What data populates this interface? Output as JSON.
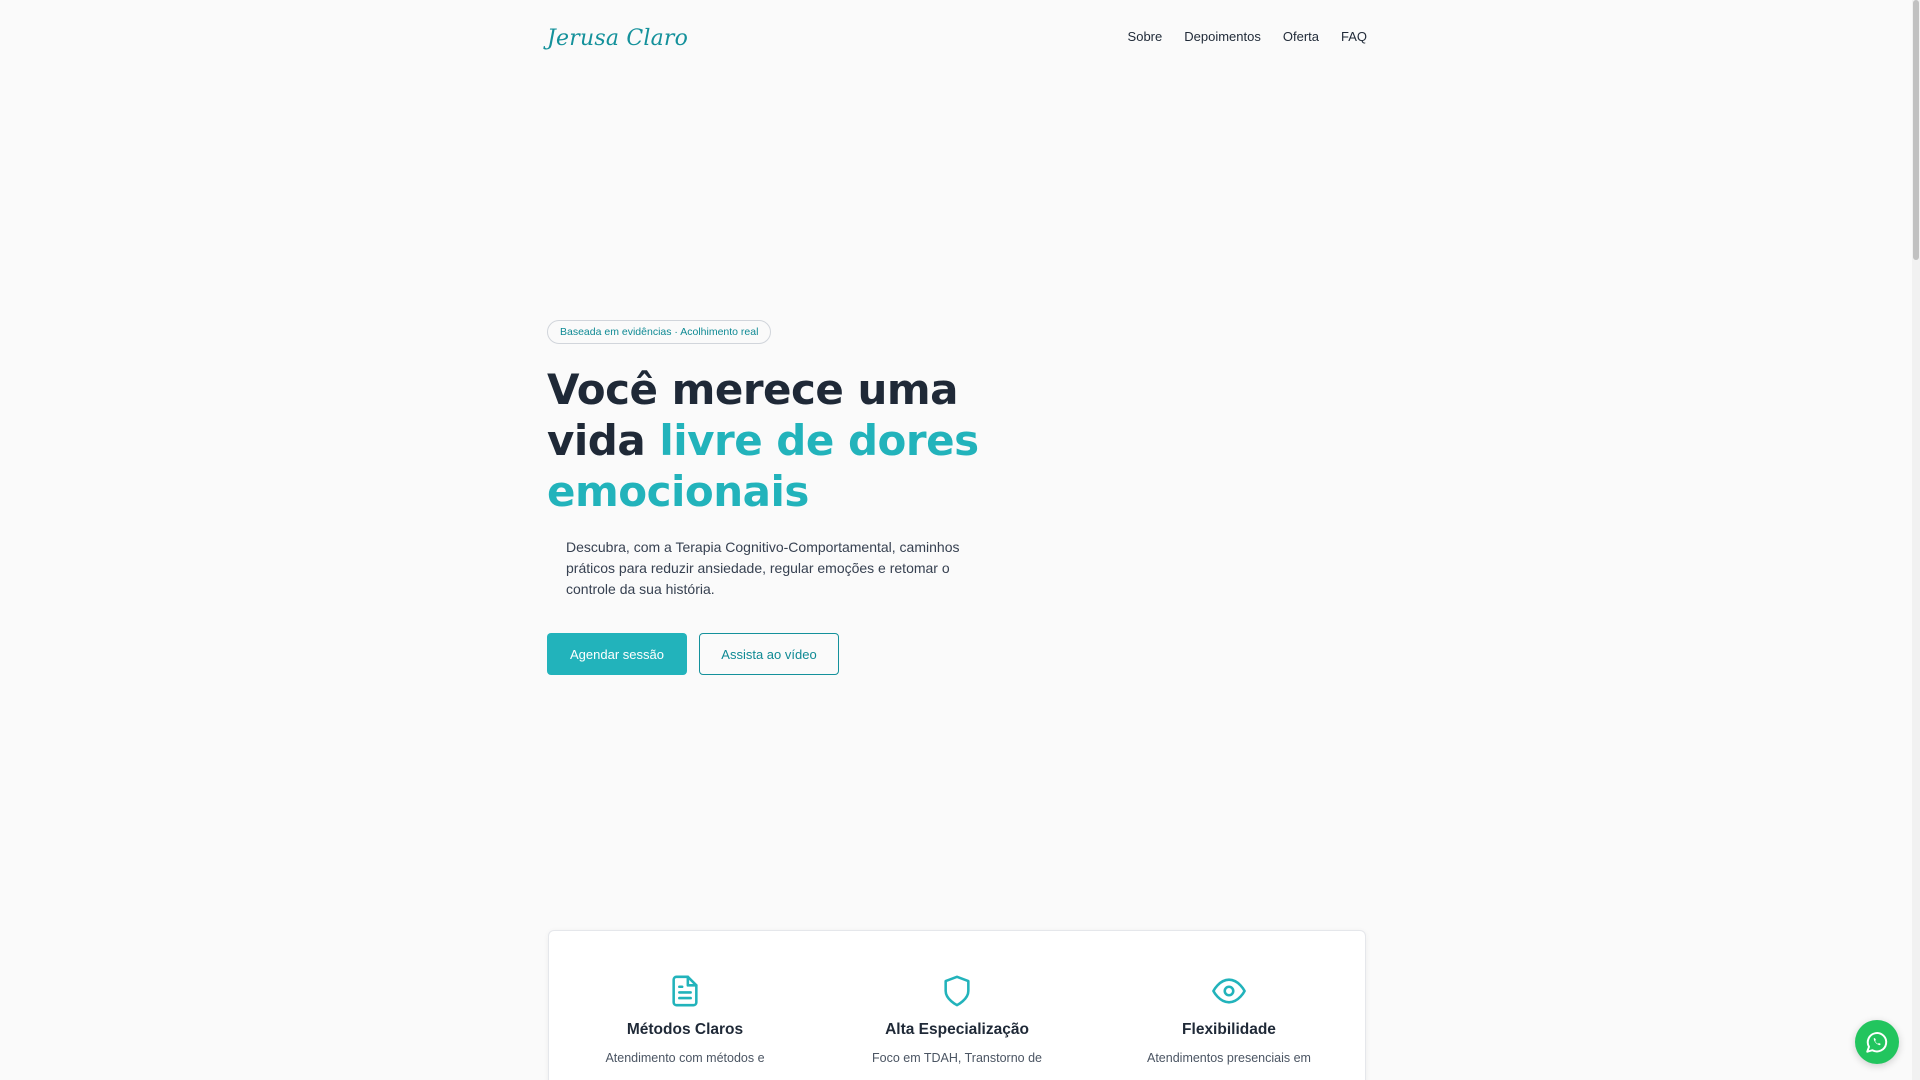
{
  "brand": {
    "logo_text": "Jerusa Claro"
  },
  "nav": {
    "items": [
      {
        "label": "Sobre"
      },
      {
        "label": "Depoimentos"
      },
      {
        "label": "Oferta"
      },
      {
        "label": "FAQ"
      }
    ]
  },
  "hero": {
    "badge": "Baseada em evidências · Acolhimento real",
    "headline_part1": "Você merece uma vida ",
    "headline_accent": "livre de dores emocionais",
    "description": "Descubra, com a Terapia Cognitivo-Comportamental, caminhos práticos para reduzir ansiedade, regular emoções e retomar o controle da sua história.",
    "primary_cta": "Agendar sessão",
    "secondary_cta": "Assista ao vídeo"
  },
  "features": [
    {
      "icon": "document-icon",
      "title": "Métodos Claros",
      "text": "Atendimento com métodos e"
    },
    {
      "icon": "shield-icon",
      "title": "Alta Especialização",
      "text": "Foco em TDAH, Transtorno de"
    },
    {
      "icon": "eye-icon",
      "title": "Flexibilidade",
      "text": "Atendimentos presenciais em"
    }
  ],
  "colors": {
    "accent": "#22b3bb",
    "accent_dark": "#14919b",
    "background": "#fafafa",
    "text": "#1f2937",
    "whatsapp": "#22c55e"
  },
  "floating": {
    "whatsapp_icon": "whatsapp-icon"
  }
}
